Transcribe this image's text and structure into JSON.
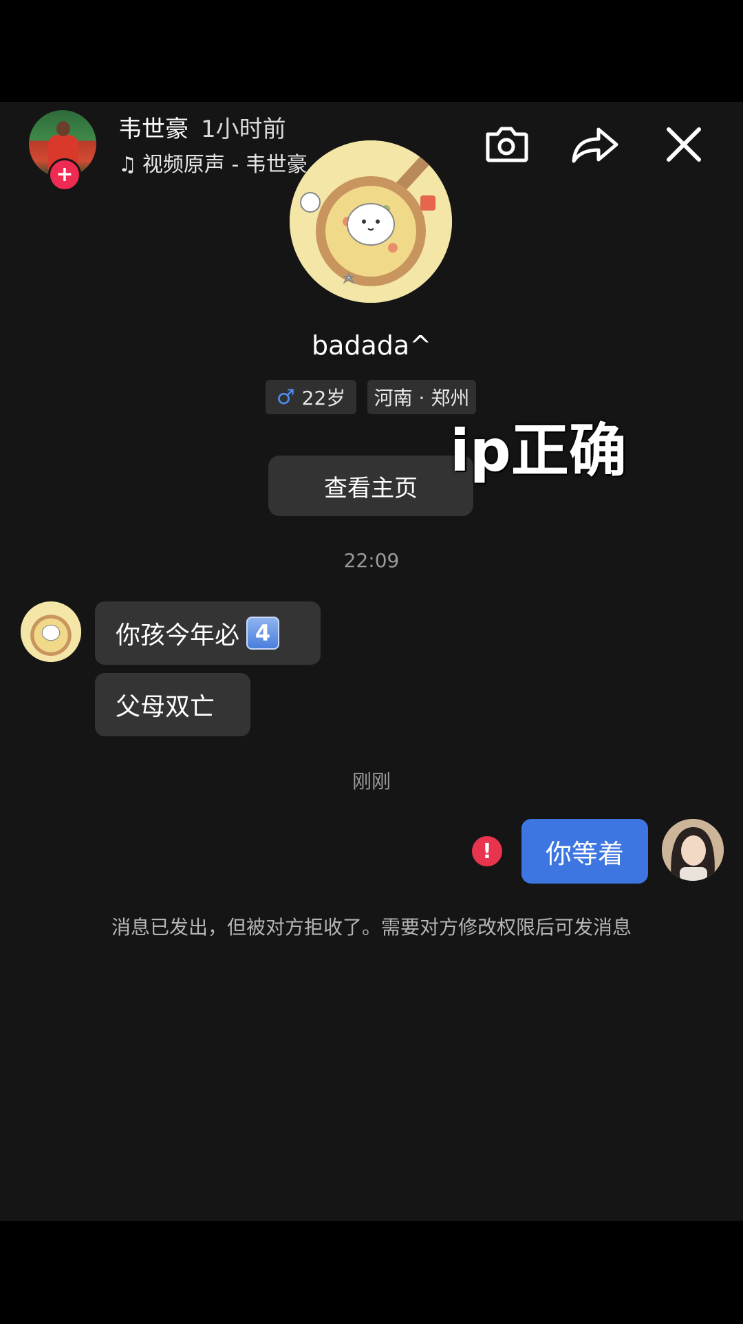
{
  "header": {
    "author_name": "韦世豪",
    "post_time": "1小时前",
    "music_note": "♫",
    "music_label": "视频原声 - 韦世豪",
    "chevron": "›",
    "follow_symbol": "+",
    "icons": [
      "camera-icon",
      "share-icon",
      "close-icon"
    ]
  },
  "profile": {
    "nickname": "badada^",
    "gender_symbol": "♂",
    "age": "22岁",
    "location": "河南 · 郑州",
    "view_profile_label": "查看主页"
  },
  "overlay_caption": "ip正确",
  "chat": {
    "timestamp_1": "22:09",
    "incoming": [
      {
        "text": "你孩今年必",
        "emoji": "4"
      },
      {
        "text": "父母双亡"
      }
    ],
    "timestamp_2": "刚刚",
    "outgoing": [
      {
        "text": "你等着",
        "status": "failed"
      }
    ],
    "failed_symbol": "!",
    "notice": "消息已发出，但被对方拒收了。需要对方修改权限后可发消息"
  },
  "colors": {
    "background": "#151515",
    "bubble_incoming": "#343434",
    "bubble_outgoing": "#3d76e0",
    "error_red": "#e8344e",
    "follow_red": "#ee2b52",
    "male_blue": "#4f8cf5"
  }
}
